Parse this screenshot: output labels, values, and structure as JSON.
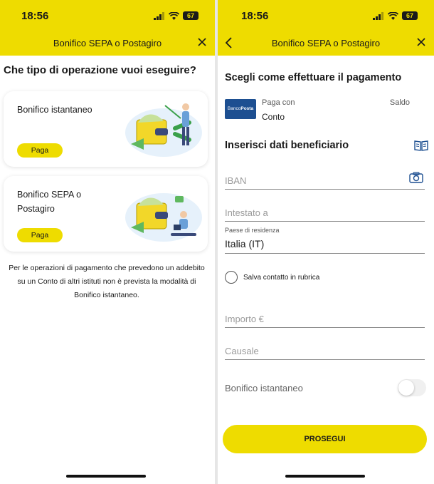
{
  "colors": {
    "accent": "#eedc00",
    "brand_blue": "#1d4f91",
    "text": "#1a1a1a"
  },
  "left": {
    "status": {
      "time": "18:56",
      "battery": "67"
    },
    "nav": {
      "title": "Bonifico SEPA o Postagiro",
      "close_icon": "close-icon"
    },
    "question": "Che tipo di operazione vuoi eseguire?",
    "cards": [
      {
        "title": "Bonifico istantaneo",
        "button": "Paga",
        "illustration": "wallet-scissors-illustration"
      },
      {
        "title": "Bonifico SEPA o Postagiro",
        "button": "Paga",
        "illustration": "wallet-person-illustration"
      }
    ],
    "note": "Per le operazioni di pagamento che prevedono un addebito su un Conto di altri istituti non è prevista la modalità di Bonifico istantaneo."
  },
  "right": {
    "status": {
      "time": "18:56",
      "battery": "67"
    },
    "nav": {
      "title": "Bonifico SEPA o Postagiro",
      "back_icon": "chevron-left-icon",
      "close_icon": "close-icon"
    },
    "payment_section": {
      "heading": "Scegli come effettuare il pagamento",
      "logo_text_a": "Banco",
      "logo_text_b": "Posta",
      "pay_with": "Paga con",
      "account": "Conto",
      "balance_label": "Saldo"
    },
    "beneficiary_section": {
      "heading": "Inserisci dati beneficiario",
      "address_book_icon": "address-book-icon",
      "iban_placeholder": "IBAN",
      "camera_icon": "camera-icon",
      "holder_placeholder": "Intestato a",
      "country_label": "Paese di residenza",
      "country_value": "Italia (IT)",
      "save_contact": "Salva contatto in rubrica",
      "amount_placeholder": "Importo €",
      "reason_placeholder": "Causale",
      "instant_toggle_label": "Bonifico istantaneo",
      "instant_enabled": false
    },
    "continue_button": "PROSEGUI"
  }
}
